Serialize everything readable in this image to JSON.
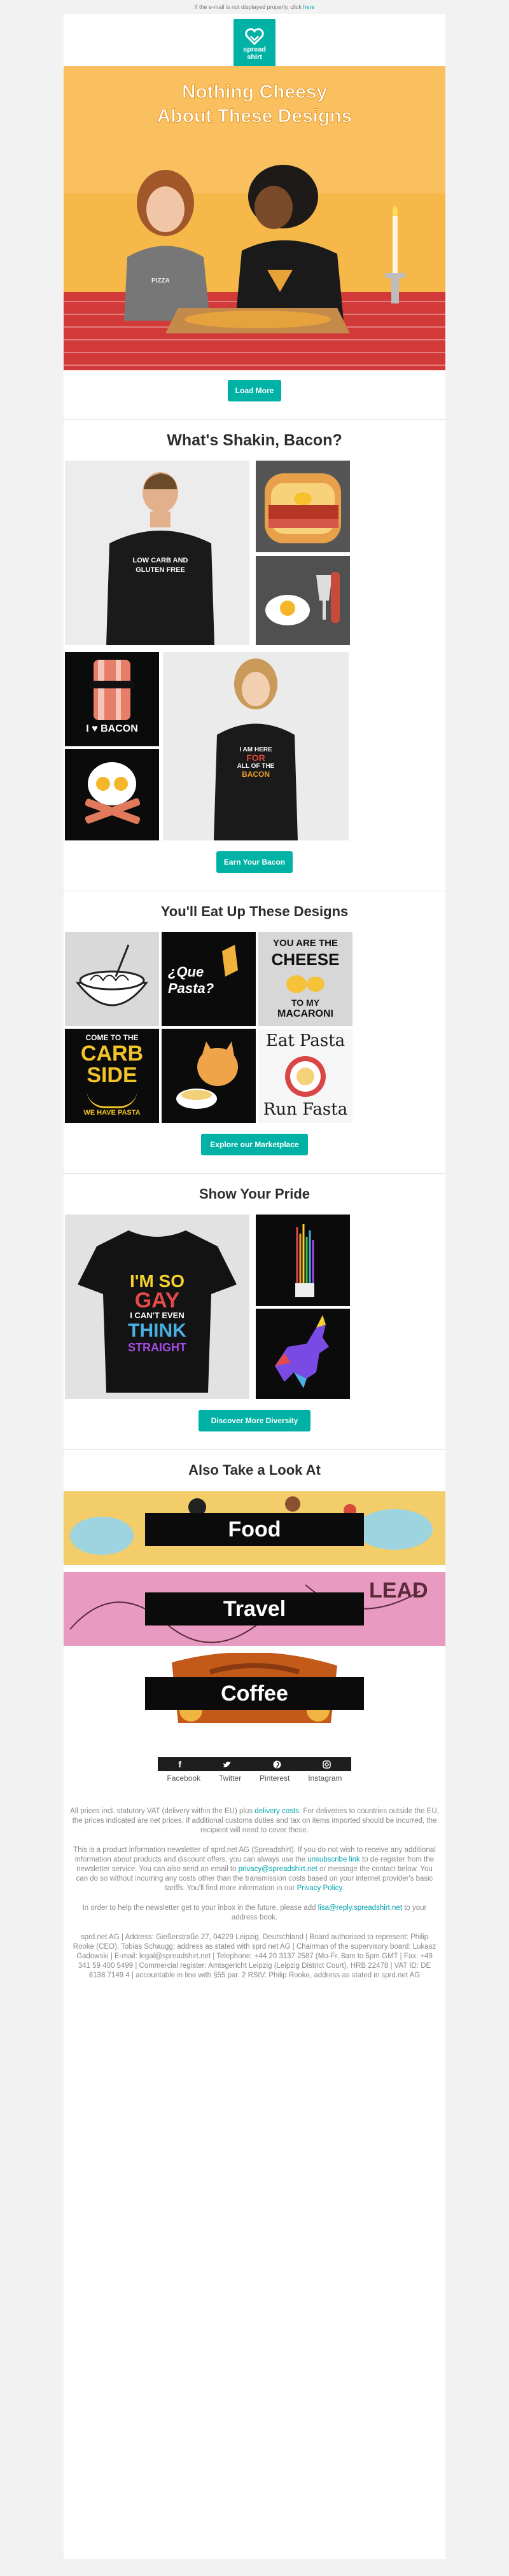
{
  "preheader": {
    "text": "If the e-mail is not displayed properly, click",
    "link": "here"
  },
  "logo": {
    "line1": "spread",
    "line2": "shirt"
  },
  "hero": {
    "title_line1": "Nothing Cheesy",
    "title_line2": "About These Designs",
    "shirt_text": "PIZZA",
    "cta": "Load More"
  },
  "bacon": {
    "heading": "What's Shakin, Bacon?",
    "shirt1_line1": "LOW CARB AND",
    "shirt1_line2": "GLUTEN FREE",
    "tile_bacon": "I ♥ BACON",
    "shirt2_line1": "I AM HERE",
    "shirt2_line2": "FOR",
    "shirt2_line3": "ALL OF THE",
    "shirt2_line4": "BACON",
    "cta": "Earn Your Bacon"
  },
  "pasta": {
    "heading": "You'll Eat Up These Designs",
    "que_pasta": "¿Que Pasta?",
    "cheese_line1": "YOU ARE THE",
    "cheese_line2": "CHEESE",
    "cheese_line3": "TO MY",
    "cheese_line4": "MACARONI",
    "carb_line1": "COME TO THE",
    "carb_line2": "CARB",
    "carb_line3": "SIDE",
    "carb_line4": "WE HAVE PASTA",
    "eat_line1": "Eat Pasta",
    "eat_line2": "Run Fasta",
    "cta": "Explore our Marketplace"
  },
  "pride": {
    "heading": "Show Your Pride",
    "line1": "I'M SO",
    "line2": "GAY",
    "line3": "I CAN'T EVEN",
    "line4": "THINK",
    "line5": "STRAIGHT",
    "cta": "Discover More Diversity"
  },
  "also": {
    "heading": "Also Take a Look At",
    "banners": [
      {
        "label": "Food"
      },
      {
        "label": "Travel"
      },
      {
        "label": "Coffee"
      }
    ]
  },
  "social": {
    "items": [
      "Facebook",
      "Twitter",
      "Pinterest",
      "Instagram"
    ]
  },
  "footer": {
    "p1_a": "All prices incl. statutory VAT (delivery within the EU) plus",
    "p1_link": "delivery costs",
    "p1_b": ". For deliveries to countries outside the EU, the prices indicated are net prices. If additional customs duties and tax on items imported should be incurred, the recipient will need to cover these.",
    "p2_a": "This is a product information newsletter of sprd.net AG (Spreadshirt). If you do not wish to receive any additional information about products and discount offers, you can always use the",
    "p2_link1": "unsubscribe link",
    "p2_b": "to de-register from the newsletter service. You can also send an email to",
    "p2_link2": "privacy@spreadshirt.net",
    "p2_c": "or message the contact below. You can do so without incurring any costs other than the transmission costs based on your internet provider's basic tariffs. You'll find more information in our",
    "p2_link3": "Privacy Policy",
    "p3_a": "In order to help the newsletter get to your inbox in the future, please add",
    "p3_link": "lisa@reply.spreadshirt.net",
    "p3_b": "to your address book.",
    "p4": "sprd.net AG | Address: Gießerstraße 27, 04229 Leipzig, Deutschland | Board authorised to represent: Philip Rooke (CEO), Tobias Schaugg; address as stated with sprd net AG | Chairman of the supervisory board: Lukasz Gadowski | E-mail: legal@spreadshirt.net | Telephone: +44 20 3137 2587 (Mo-Fr, 8am to 5pm GMT | Fax: +49 341 59 400 5499 | Commercial register: Amtsgericht Leipzig (Leipzig District Court), HRB 22478 | VAT ID: DE 8138 7149 4 | accountable in line with §55 par. 2 RStV: Philip Rooke, address as stated in sprd.net AG"
  },
  "colors": {
    "accent": "#00b2a5",
    "hero_bg": "#f7b84a",
    "title": "#2d2d2d"
  }
}
